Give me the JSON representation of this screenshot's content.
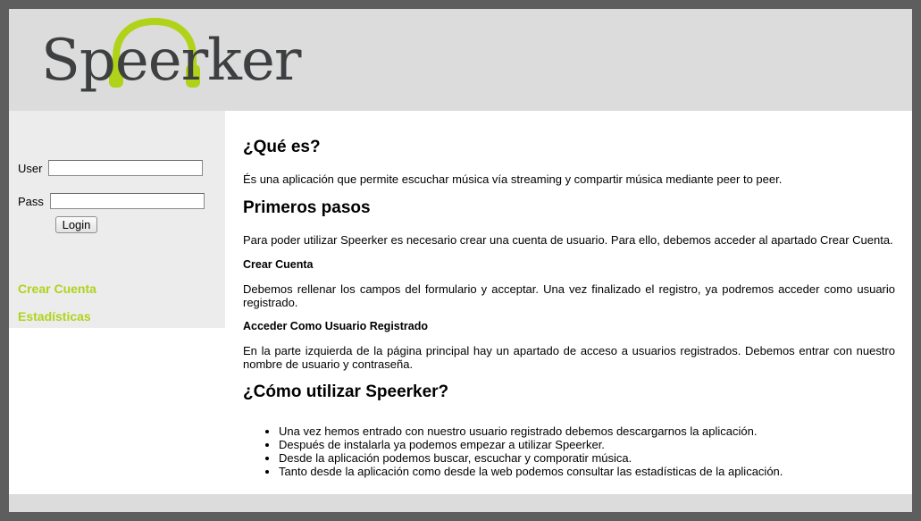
{
  "header": {
    "logo_text": "Speerker"
  },
  "login": {
    "user_label": "User",
    "user_value": "",
    "pass_label": "Pass",
    "pass_value": "",
    "button_label": "Login"
  },
  "sidebar": {
    "links": [
      {
        "label": "Crear Cuenta"
      },
      {
        "label": "Estadísticas"
      }
    ]
  },
  "main": {
    "section1": {
      "title": "¿Qué es?",
      "text": "És una aplicación que permite escuchar música vía streaming y compartir música mediante peer to peer."
    },
    "section2": {
      "title": "Primeros pasos",
      "intro": "Para poder utilizar Speerker es necesario crear una cuenta de usuario. Para ello, debemos acceder al apartado Crear Cuenta.",
      "sub1_title": "Crear Cuenta",
      "sub1_text": "Debemos rellenar los campos del formulario y acceptar. Una vez finalizado el registro, ya podremos acceder como usuario registrado.",
      "sub2_title": "Acceder Como Usuario Registrado",
      "sub2_text": "En la parte izquierda de la página principal hay un apartado de acceso a usuarios registrados. Debemos entrar con nuestro nombre de usuario y contraseña."
    },
    "section3": {
      "title": "¿Cómo utilizar Speerker?",
      "items": [
        "Una vez hemos entrado con nuestro usuario registrado debemos descargarnos la aplicación.",
        "Después de instalarla ya podemos empezar a utilizar Speerker.",
        "Desde la aplicación podemos buscar, escuchar y comporatir música.",
        "Tanto desde la aplicación como desde la web podemos consultar las estadísticas de la aplicación."
      ]
    }
  },
  "colors": {
    "accent": "#b0d31a",
    "header_bg": "#dcdcdc",
    "sidebar_bg": "#ececec",
    "frame_bg": "#5e5e5e"
  }
}
